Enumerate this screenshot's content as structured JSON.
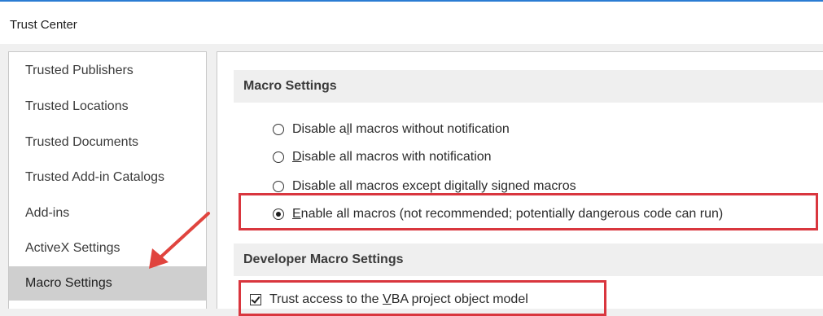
{
  "window": {
    "title": "Trust Center"
  },
  "colors": {
    "accent": "#2b7cd3",
    "highlight": "#d9363e",
    "annotation_arrow": "#e0443e"
  },
  "sidebar": {
    "items": [
      {
        "label": "Trusted Publishers",
        "selected": false
      },
      {
        "label": "Trusted Locations",
        "selected": false
      },
      {
        "label": "Trusted Documents",
        "selected": false
      },
      {
        "label": "Trusted Add-in Catalogs",
        "selected": false
      },
      {
        "label": "Add-ins",
        "selected": false
      },
      {
        "label": "ActiveX Settings",
        "selected": false
      },
      {
        "label": "Macro Settings",
        "selected": true
      }
    ]
  },
  "macro_settings": {
    "header": "Macro Settings",
    "options": [
      {
        "pre": "Disable a",
        "ul": "l",
        "post": "l macros without notification",
        "checked": false
      },
      {
        "pre": "",
        "ul": "D",
        "post": "isable all macros with notification",
        "checked": false
      },
      {
        "pre": "Disable all macros except di",
        "ul": "g",
        "post": "itally signed macros",
        "checked": false
      },
      {
        "pre": "",
        "ul": "E",
        "post": "nable all macros (not recommended; potentially dangerous code can run)",
        "checked": true
      }
    ]
  },
  "developer_macro_settings": {
    "header": "Developer Macro Settings",
    "trust_vba": {
      "pre": "Trust access to the ",
      "ul": "V",
      "post": "BA project object model",
      "checked": true
    }
  }
}
